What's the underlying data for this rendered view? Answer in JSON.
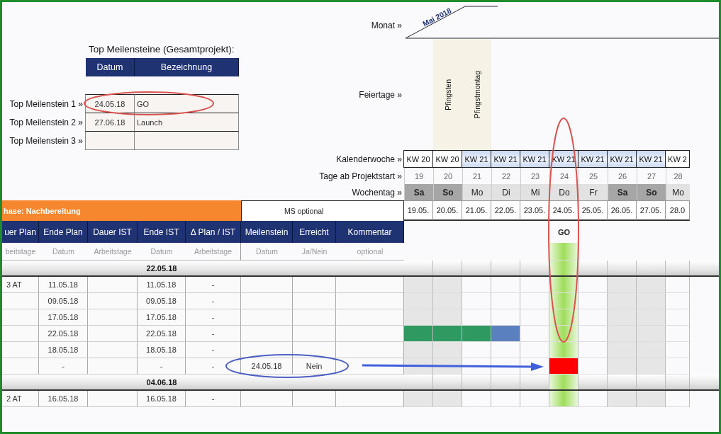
{
  "top_milestones": {
    "title": "Top Meilensteine (Gesamtprojekt):",
    "columns": [
      "Datum",
      "Bezeichnung"
    ],
    "rows": [
      {
        "label": "Top Meilenstein 1 »",
        "date": "24.05.18",
        "name": "GO"
      },
      {
        "label": "Top Meilenstein 2 »",
        "date": "27.06.18",
        "name": "Launch"
      },
      {
        "label": "Top Meilenstein 3 »"
      }
    ]
  },
  "timeline_labels": {
    "month": "Monat »",
    "holidays": "Feiertage »",
    "week": "Kalenderwoche »",
    "day_count": "Tage ab Projektstart »",
    "weekday": "Wochentag »"
  },
  "month": "Mai 2018",
  "days": [
    {
      "kw": "KW 20",
      "kw_highlighted": false,
      "day_count": "19",
      "weekday": "Sa",
      "weekend": true,
      "date": "19.05."
    },
    {
      "kw": "KW 20",
      "kw_highlighted": false,
      "day_count": "20",
      "weekday": "So",
      "weekend": true,
      "date": "20.05.",
      "holiday": "Pfingsten"
    },
    {
      "kw": "KW 21",
      "kw_highlighted": true,
      "day_count": "21",
      "weekday": "Mo",
      "weekend": false,
      "date": "21.05.",
      "holiday": "Pfingstmontag"
    },
    {
      "kw": "KW 21",
      "kw_highlighted": true,
      "day_count": "22",
      "weekday": "Di",
      "weekend": false,
      "date": "22.05."
    },
    {
      "kw": "KW 21",
      "kw_highlighted": true,
      "day_count": "23",
      "weekday": "Mi",
      "weekend": false,
      "date": "23.05."
    },
    {
      "kw": "KW 21",
      "kw_highlighted": true,
      "day_count": "24",
      "weekday": "Do",
      "weekend": false,
      "date": "24.05.",
      "milestone": "GO"
    },
    {
      "kw": "KW 21",
      "kw_highlighted": true,
      "day_count": "25",
      "weekday": "Fr",
      "weekend": false,
      "date": "25.05."
    },
    {
      "kw": "KW 21",
      "kw_highlighted": true,
      "day_count": "26",
      "weekday": "Sa",
      "weekend": true,
      "date": "26.05."
    },
    {
      "kw": "KW 21",
      "kw_highlighted": true,
      "day_count": "27",
      "weekday": "So",
      "weekend": true,
      "date": "27.05."
    },
    {
      "kw": "KW 2",
      "kw_highlighted": false,
      "day_count": "28",
      "weekday": "Mo",
      "weekend": false,
      "date": "28.0"
    }
  ],
  "phase": {
    "title": "hase: Nachbereitung",
    "ms_label": "MS optional"
  },
  "columns": [
    {
      "label": "uer Plan",
      "unit": "beitstage"
    },
    {
      "label": "Ende Plan",
      "unit": "Datum"
    },
    {
      "label": "Dauer IST",
      "unit": "Arbeitstage"
    },
    {
      "label": "Ende IST",
      "unit": "Datum"
    },
    {
      "label": "Δ Plan / IST",
      "unit": "Arbeitstage"
    },
    {
      "label": "Meilenstein",
      "unit": "Datum"
    },
    {
      "label": "Erreicht",
      "unit": "Ja/Nein"
    },
    {
      "label": "Kommentar",
      "unit": "optional"
    }
  ],
  "rows": [
    {
      "kind": "group",
      "date": "22.05.18"
    },
    {
      "kind": "task",
      "dauer_plan": "3 AT",
      "ende_plan": "11.05.18",
      "ende_ist": "11.05.18",
      "delta": "-",
      "gantt": [
        {
          "filled": false
        },
        {
          "filled": false
        },
        {
          "filled": false
        },
        {
          "filled": false
        },
        {
          "filled": false
        },
        {
          "filled": false
        },
        {
          "filled": false
        },
        {
          "filled": false
        },
        {
          "filled": false
        },
        {
          "filled": false
        }
      ]
    },
    {
      "kind": "task",
      "ende_plan": "09.05.18",
      "ende_ist": "09.05.18",
      "delta": "-",
      "gantt": [
        {
          "filled": false
        },
        {
          "filled": false
        },
        {
          "filled": false
        },
        {
          "filled": false
        },
        {
          "filled": false
        },
        {
          "filled": false
        },
        {
          "filled": false
        },
        {
          "filled": false
        },
        {
          "filled": false
        },
        {
          "filled": false
        }
      ]
    },
    {
      "kind": "task",
      "ende_plan": "17.05.18",
      "ende_ist": "17.05.18",
      "delta": "-",
      "gantt": [
        {
          "filled": false
        },
        {
          "filled": false
        },
        {
          "filled": false
        },
        {
          "filled": false
        },
        {
          "filled": false
        },
        {
          "filled": false
        },
        {
          "filled": false
        },
        {
          "filled": false
        },
        {
          "filled": false
        },
        {
          "filled": false
        }
      ]
    },
    {
      "kind": "task",
      "ende_plan": "22.05.18",
      "ende_ist": "22.05.18",
      "delta": "-",
      "gantt": [
        {
          "filled": true,
          "color": "#2e9a62"
        },
        {
          "filled": true,
          "color": "#2e9a62"
        },
        {
          "filled": true,
          "color": "#2e9a62"
        },
        {
          "filled": true,
          "color": "#5b80c0"
        },
        {
          "filled": false
        },
        {
          "filled": false
        },
        {
          "filled": false
        },
        {
          "filled": false
        },
        {
          "filled": false
        },
        {
          "filled": false
        }
      ]
    },
    {
      "kind": "task",
      "ende_plan": "18.05.18",
      "ende_ist": "18.05.18",
      "delta": "-",
      "gantt": [
        {
          "filled": false
        },
        {
          "filled": false
        },
        {
          "filled": false
        },
        {
          "filled": false
        },
        {
          "filled": false
        },
        {
          "filled": false
        },
        {
          "filled": false
        },
        {
          "filled": false
        },
        {
          "filled": false
        },
        {
          "filled": false
        }
      ]
    },
    {
      "kind": "task",
      "ende_plan": "-",
      "ende_ist": "-",
      "delta": "-",
      "meilenstein": "24.05.18",
      "erreicht": "Nein",
      "gantt": [
        {
          "filled": false
        },
        {
          "filled": false
        },
        {
          "filled": false
        },
        {
          "filled": false
        },
        {
          "filled": false
        },
        {
          "filled": true,
          "color": "#ff0000"
        },
        {
          "filled": false
        },
        {
          "filled": false
        },
        {
          "filled": false
        },
        {
          "filled": false
        }
      ]
    },
    {
      "kind": "group",
      "date": "04.06.18"
    },
    {
      "kind": "task",
      "dauer_plan": "2 AT",
      "ende_plan": "16.05.18",
      "ende_ist": "16.05.18",
      "delta": "-",
      "gantt": [
        {
          "filled": false
        },
        {
          "filled": false
        },
        {
          "filled": false
        },
        {
          "filled": false
        },
        {
          "filled": false
        },
        {
          "filled": false
        },
        {
          "filled": false
        },
        {
          "filled": false
        },
        {
          "filled": false
        },
        {
          "filled": false
        }
      ]
    }
  ]
}
